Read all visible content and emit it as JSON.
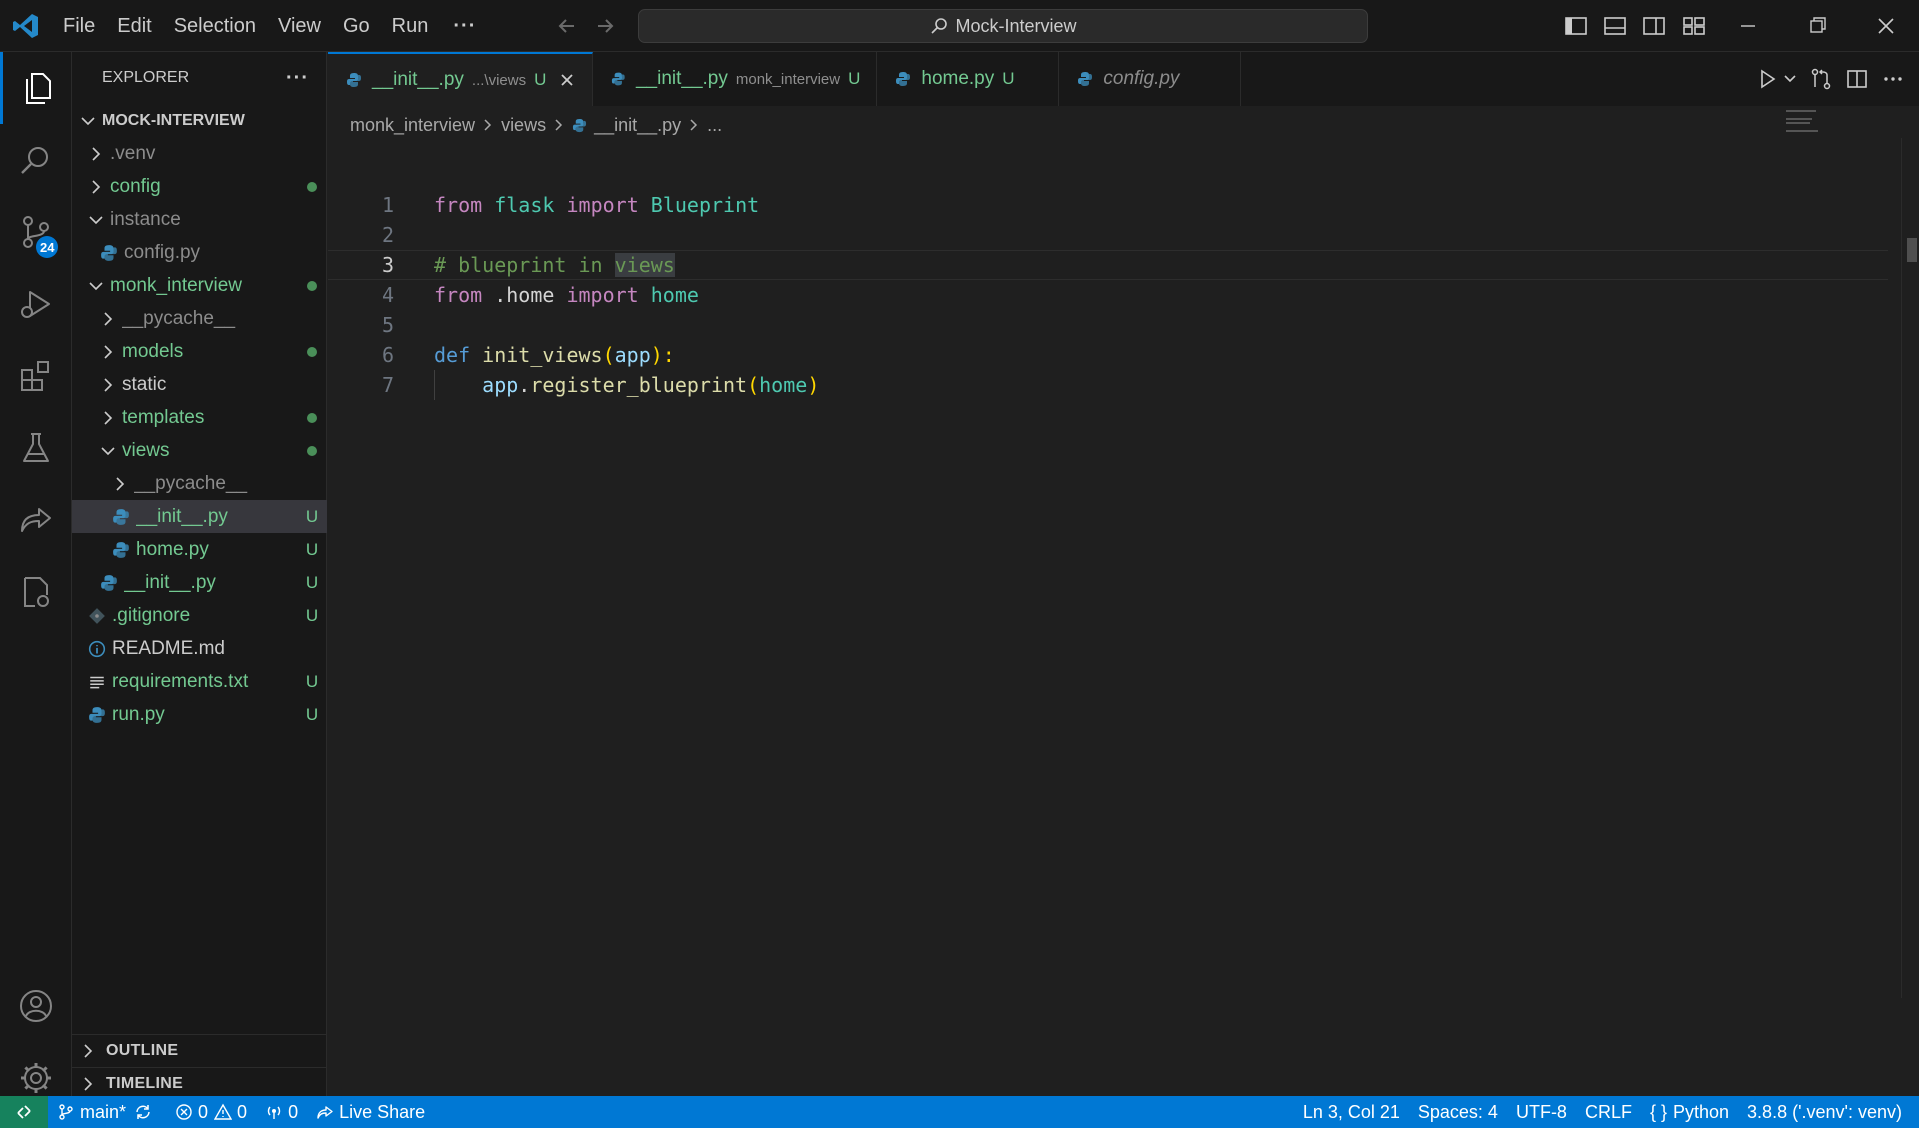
{
  "titlebar": {
    "menu": [
      "File",
      "Edit",
      "Selection",
      "View",
      "Go",
      "Run"
    ],
    "more": "···",
    "command_center": "Mock-Interview"
  },
  "activitybar": {
    "source_control_badge": "24"
  },
  "explorer": {
    "title": "EXPLORER",
    "more": "···",
    "root": "MOCK-INTERVIEW",
    "items": [
      {
        "name": ".venv",
        "color": "dim",
        "deco": ""
      },
      {
        "name": "config",
        "color": "green",
        "deco": "dot"
      },
      {
        "name": "instance",
        "color": "dim",
        "deco": ""
      },
      {
        "name": "config.py",
        "color": "dim",
        "deco": ""
      },
      {
        "name": "monk_interview",
        "color": "green",
        "deco": "dot"
      },
      {
        "name": "__pycache__",
        "color": "dim",
        "deco": ""
      },
      {
        "name": "models",
        "color": "green",
        "deco": "dot"
      },
      {
        "name": "static",
        "color": "white",
        "deco": ""
      },
      {
        "name": "templates",
        "color": "green",
        "deco": "dot"
      },
      {
        "name": "views",
        "color": "green",
        "deco": "dot"
      },
      {
        "name": "__pycache__",
        "color": "dim",
        "deco": ""
      },
      {
        "name": "__init__.py",
        "color": "green",
        "deco": "U"
      },
      {
        "name": "home.py",
        "color": "green",
        "deco": "U"
      },
      {
        "name": "__init__.py",
        "color": "green",
        "deco": "U"
      },
      {
        "name": ".gitignore",
        "color": "green",
        "deco": "U"
      },
      {
        "name": "README.md",
        "color": "white",
        "deco": ""
      },
      {
        "name": "requirements.txt",
        "color": "green",
        "deco": "U"
      },
      {
        "name": "run.py",
        "color": "green",
        "deco": "U"
      }
    ],
    "outline": "OUTLINE",
    "timeline": "TIMELINE"
  },
  "tabs": [
    {
      "label": "__init__.py",
      "desc": "...\\views",
      "status": "U"
    },
    {
      "label": "__init__.py",
      "desc": "monk_interview",
      "status": "U"
    },
    {
      "label": "home.py",
      "desc": "",
      "status": "U"
    },
    {
      "label": "config.py",
      "desc": "",
      "status": ""
    }
  ],
  "breadcrumb": [
    "monk_interview",
    "views",
    "__init__.py",
    "..."
  ],
  "code": {
    "line_numbers": [
      "1",
      "2",
      "3",
      "4",
      "5",
      "6",
      "7"
    ],
    "l1": [
      "from",
      " ",
      "flask",
      " ",
      "import",
      " ",
      "Blueprint"
    ],
    "l3": [
      "# blueprint in ",
      "views"
    ],
    "l4": [
      "from",
      " .home ",
      "import",
      " ",
      "home"
    ],
    "l6": [
      "def",
      " ",
      "init_views",
      "(",
      "app",
      "):"
    ],
    "l7": [
      "    ",
      "app",
      ".",
      "register_blueprint",
      "(",
      "home",
      ")"
    ]
  },
  "statusbar": {
    "branch": "main*",
    "errors": "0",
    "warnings": "0",
    "ports": "0",
    "live_share": "Live Share",
    "cursor": "Ln 3, Col 21",
    "spaces": "Spaces: 4",
    "encoding": "UTF-8",
    "eol": "CRLF",
    "language": "Python",
    "interpreter": "3.8.8 ('.venv': venv)"
  },
  "colors": {
    "accent": "#0078d4",
    "modified_dot": "#4a8f59",
    "untracked": "#73c991"
  }
}
